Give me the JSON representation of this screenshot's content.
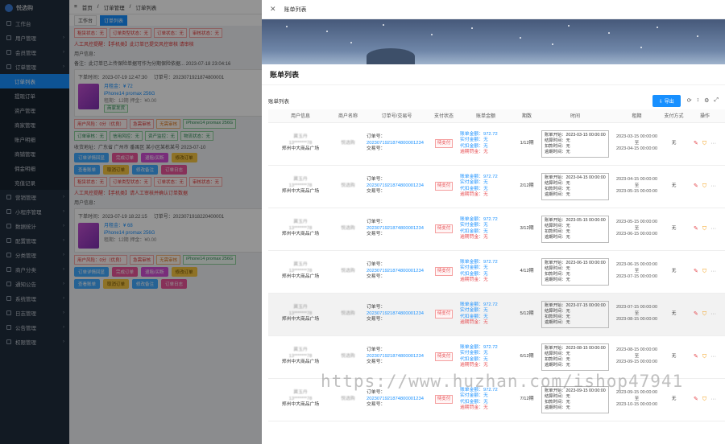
{
  "sidebar": {
    "logo": "悦选购",
    "items": [
      {
        "label": "工作台"
      },
      {
        "label": "用户管理"
      },
      {
        "label": "会员管理"
      },
      {
        "label": "订单管理"
      }
    ],
    "subitems": [
      {
        "label": "订单列表",
        "active": true
      },
      {
        "label": "提现订单"
      },
      {
        "label": "资产管理"
      },
      {
        "label": "商家管理"
      },
      {
        "label": "账户明细"
      },
      {
        "label": "商铺管理"
      },
      {
        "label": "佣金明细"
      },
      {
        "label": "充值记录"
      }
    ],
    "items2": [
      {
        "label": "营销管理"
      },
      {
        "label": "小程序管理"
      },
      {
        "label": "数据统计"
      },
      {
        "label": "配置管理"
      },
      {
        "label": "分类管理"
      },
      {
        "label": "商户分类"
      },
      {
        "label": "通知公告"
      },
      {
        "label": "系统管理"
      },
      {
        "label": "日志管理"
      },
      {
        "label": "公告管理"
      },
      {
        "label": "权限管理"
      }
    ]
  },
  "background": {
    "breadcrumb": [
      "首页",
      "订单管理",
      "订单列表"
    ],
    "tabs": [
      "工作台",
      "订单列表"
    ],
    "tags1": [
      "租赁状态：无",
      "订单类型状态：无",
      "订单状态：无",
      "审核状态：无"
    ],
    "notice1": "人工风控提醒：【手机类】此订单已提交风控审核 请审核",
    "user_label": "用户信息：",
    "remark": "备注：此订单已上传保险单据可作为分期保险依据... 2023-07-18 23:04:16",
    "order1": {
      "time": "下单时间：2023-07-19 12:47:30",
      "no": "订单号：2023071921874800001"
    },
    "product1": {
      "price": "月租金：¥ 72",
      "name": "iPhone14 promax 256G",
      "extra": "租期：12期 押金：¥0.00",
      "badge": "商家发货"
    },
    "tags2": [
      "用户风险：0分（优良）",
      "急需审核",
      "无需审核",
      "iPhone14 promax 256G"
    ],
    "tags3": [
      "订单审核：无",
      "信用风控：无",
      "资产监控：无",
      "物流状态：无"
    ],
    "buyer_line": "收货地址：广东省 广州市 番禺区 某小区某栋某号 2023-07-10",
    "buttons1": [
      "订单详情回显",
      "完成订单",
      "退租/买断",
      "修改订单"
    ],
    "buttons2": [
      "查看账单",
      "取消订单",
      "修改备注",
      "订单日志"
    ],
    "notice2": "人工风控提醒：【手机类】请人工审核并确认订单数据",
    "order2": {
      "time": "下单时间：2023-07-19 18:22:15",
      "no": "订单号：2023071918220400001"
    },
    "product2": {
      "price": "月租金：¥ 68",
      "name": "iPhone14 promax 256G",
      "extra": "租期：12期 押金：¥0.00"
    },
    "tags4": [
      "用户风险：0分（优良）",
      "急需审核",
      "无需审核",
      "iPhone14 promax 256G"
    ]
  },
  "drawer": {
    "header_title": "账单列表",
    "close_icon": "close-icon",
    "title": "账单列表",
    "table_label": "账单列表",
    "export_label": "导出",
    "columns": [
      "用户信息",
      "商户名称",
      "订单号/交易号",
      "支付状态",
      "账单金额",
      "期数",
      "时间",
      "租期",
      "支付方式",
      "操作"
    ],
    "rows": [
      {
        "user": "冀玉丹",
        "phone": "13*******78",
        "addr": "郑州中大商品广场",
        "merchant": "悦选购",
        "order_no": "2023071921874800001234",
        "trade_no": "交易号：",
        "status": "待支付",
        "amount": "账单金额：972.72",
        "paid": "实付金额：无",
        "deduct": "代扣金额：无",
        "penalty": "逾期罚金：无",
        "plan": "1/12期",
        "t_due": "账单开始：2023-03-15 00:00:00",
        "t_pay": "结算时间：无",
        "t_deduct": "扣款时间：无",
        "t_refund": "逾期时间：无",
        "range_start": "2023-03-15 00:00:00",
        "range_end": "2023-04-15 00:00:00",
        "pay": "无",
        "highlight": false
      },
      {
        "user": "冀玉丹",
        "phone": "13*******78",
        "addr": "郑州中大商品广场",
        "merchant": "悦选购",
        "order_no": "2023071921874800001234",
        "trade_no": "交易号：",
        "status": "待支付",
        "amount": "账单金额：972.72",
        "paid": "实付金额：无",
        "deduct": "代扣金额：无",
        "penalty": "逾期罚金：无",
        "plan": "2/12期",
        "t_due": "账单开始：2023-04-15 00:00:00",
        "t_pay": "结算时间：无",
        "t_deduct": "扣款时间：无",
        "t_refund": "逾期时间：无",
        "range_start": "2023-04-15 00:00:00",
        "range_end": "2023-05-15 00:00:00",
        "pay": "无",
        "highlight": false
      },
      {
        "user": "冀玉丹",
        "phone": "13*******78",
        "addr": "郑州中大商品广场",
        "merchant": "悦选购",
        "order_no": "2023071921874800001234",
        "trade_no": "交易号：",
        "status": "待支付",
        "amount": "账单金额：972.72",
        "paid": "实付金额：无",
        "deduct": "代扣金额：无",
        "penalty": "逾期罚金：无",
        "plan": "3/12期",
        "t_due": "账单开始：2023-05-15 00:00:00",
        "t_pay": "结算时间：无",
        "t_deduct": "扣款时间：无",
        "t_refund": "逾期时间：无",
        "range_start": "2023-05-15 00:00:00",
        "range_end": "2023-06-15 00:00:00",
        "pay": "无",
        "highlight": false
      },
      {
        "user": "冀玉丹",
        "phone": "13*******78",
        "addr": "郑州中大商品广场",
        "merchant": "悦选购",
        "order_no": "2023071921874800001234",
        "trade_no": "交易号：",
        "status": "待支付",
        "amount": "账单金额：972.72",
        "paid": "实付金额：无",
        "deduct": "代扣金额：无",
        "penalty": "逾期罚金：无",
        "plan": "4/12期",
        "t_due": "账单开始：2023-06-15 00:00:00",
        "t_pay": "结算时间：无",
        "t_deduct": "扣款时间：无",
        "t_refund": "逾期时间：无",
        "range_start": "2023-06-15 00:00:00",
        "range_end": "2023-07-15 00:00:00",
        "pay": "无",
        "highlight": false
      },
      {
        "user": "冀玉丹",
        "phone": "13*******78",
        "addr": "郑州中大商品广场",
        "merchant": "悦选购",
        "order_no": "2023071921874800001234",
        "trade_no": "交易号：",
        "status": "待支付",
        "amount": "账单金额：972.72",
        "paid": "实付金额：无",
        "deduct": "代扣金额：无",
        "penalty": "逾期罚金：无",
        "plan": "5/12期",
        "t_due": "账单开始：2023-07-15 00:00:00",
        "t_pay": "结算时间：无",
        "t_deduct": "扣款时间：无",
        "t_refund": "逾期时间：无",
        "range_start": "2023-07-15 00:00:00",
        "range_end": "2023-08-15 00:00:00",
        "pay": "无",
        "highlight": true
      },
      {
        "user": "冀玉丹",
        "phone": "13*******78",
        "addr": "郑州中大商品广场",
        "merchant": "悦选购",
        "order_no": "2023071921874800001234",
        "trade_no": "交易号：",
        "status": "待支付",
        "amount": "账单金额：972.72",
        "paid": "实付金额：无",
        "deduct": "代扣金额：无",
        "penalty": "逾期罚金：无",
        "plan": "6/12期",
        "t_due": "账单开始：2023-08-15 00:00:00",
        "t_pay": "结算时间：无",
        "t_deduct": "扣款时间：无",
        "t_refund": "逾期时间：无",
        "range_start": "2023-08-15 00:00:00",
        "range_end": "2023-09-15 00:00:00",
        "pay": "无",
        "highlight": false
      },
      {
        "user": "冀玉丹",
        "phone": "13*******78",
        "addr": "郑州中大商品广场",
        "merchant": "悦选购",
        "order_no": "2023071921874800001234",
        "trade_no": "交易号：",
        "status": "待支付",
        "amount": "账单金额：972.72",
        "paid": "实付金额：无",
        "deduct": "代扣金额：无",
        "penalty": "逾期罚金：无",
        "plan": "7/12期",
        "t_due": "账单开始：2023-09-15 00:00:00",
        "t_pay": "结算时间：无",
        "t_deduct": "扣款时间：无",
        "t_refund": "逾期时间：无",
        "range_start": "2023-09-15 00:00:00",
        "range_end": "2023-10-15 00:00:00",
        "pay": "无",
        "highlight": false
      }
    ],
    "op_icons": [
      "edit-icon",
      "shield-icon",
      "more-icon"
    ]
  },
  "watermark": "https://www.huzhan.com/ishop47941",
  "colors": {
    "primary": "#1890ff",
    "danger": "#e5484d",
    "sidebar": "#1f2d3d"
  }
}
